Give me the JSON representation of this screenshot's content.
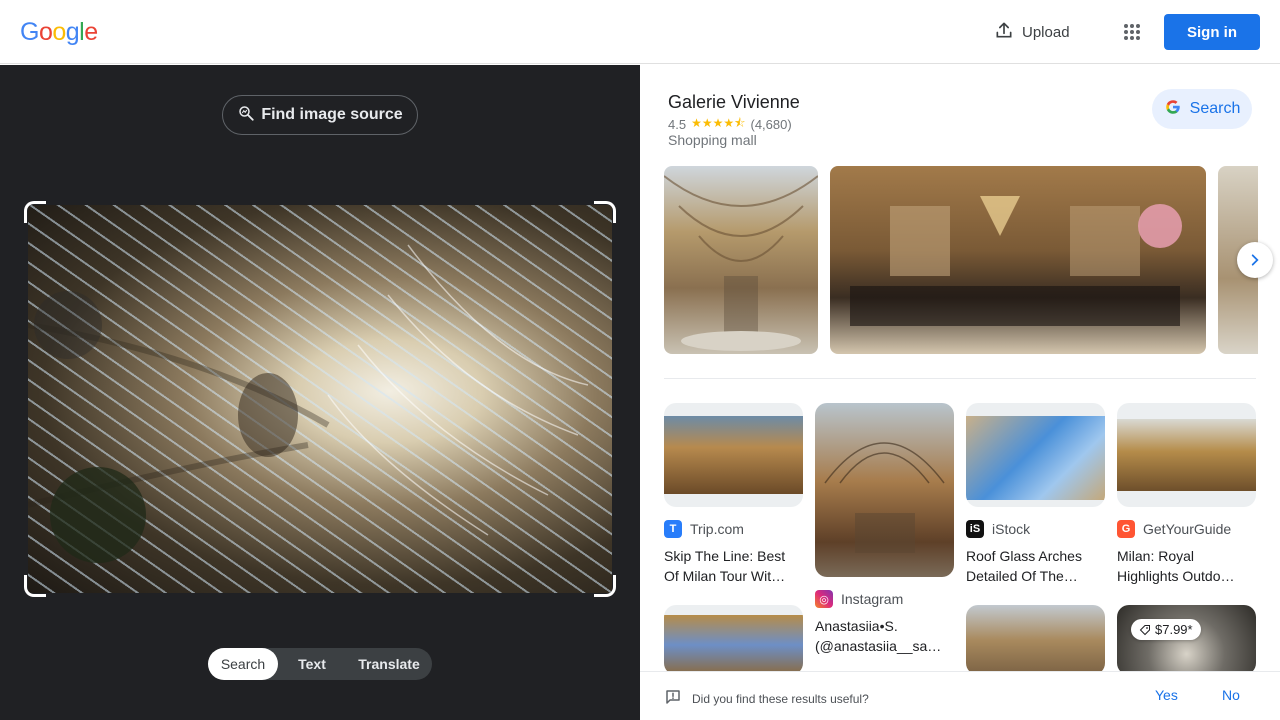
{
  "header": {
    "logo_letters": [
      {
        "char": "G",
        "color": "#4285f4"
      },
      {
        "char": "o",
        "color": "#ea4335"
      },
      {
        "char": "o",
        "color": "#fbbc05"
      },
      {
        "char": "g",
        "color": "#4285f4"
      },
      {
        "char": "l",
        "color": "#34a853"
      },
      {
        "char": "e",
        "color": "#ea4335"
      }
    ],
    "upload_label": "Upload",
    "upload_icon": "upload-icon",
    "apps_icon": "apps-grid-icon",
    "signin_label": "Sign in"
  },
  "left_panel": {
    "find_source_label": "Find image source",
    "find_source_icon": "image-search-icon",
    "modes": [
      {
        "label": "Search",
        "active": true
      },
      {
        "label": "Text",
        "active": false
      },
      {
        "label": "Translate",
        "active": false
      }
    ]
  },
  "place": {
    "title": "Galerie Vivienne",
    "rating": "4.5",
    "stars": "★★★★⯪",
    "review_count": "(4,680)",
    "category": "Shopping mall",
    "search_label": "Search"
  },
  "results": [
    {
      "source": "Trip.com",
      "fav_letter": "T",
      "fav_color": "#287dfa",
      "title_line1": "Skip The Line: Best",
      "title_line2": "Of Milan Tour Wit…"
    },
    {
      "source": "Instagram",
      "fav_letter": "◎",
      "fav_color": "#d62976",
      "title_line1": "Anastasiia•S.",
      "title_line2": "(@anastasiia__sa…"
    },
    {
      "source": "iStock",
      "fav_letter": "iS",
      "fav_color": "#111111",
      "title_line1": "Roof Glass Arches",
      "title_line2": "Detailed Of The…"
    },
    {
      "source": "GetYourGuide",
      "fav_letter": "G",
      "fav_color": "#ff5533",
      "title_line1": "Milan: Royal",
      "title_line2": "Highlights Outdo…"
    }
  ],
  "price_badge": "$7.99*",
  "footer": {
    "question": "Did you find these results useful?",
    "yes": "Yes",
    "no": "No"
  },
  "colors": {
    "accent": "#1a73e8",
    "dark_panel": "#202124"
  }
}
